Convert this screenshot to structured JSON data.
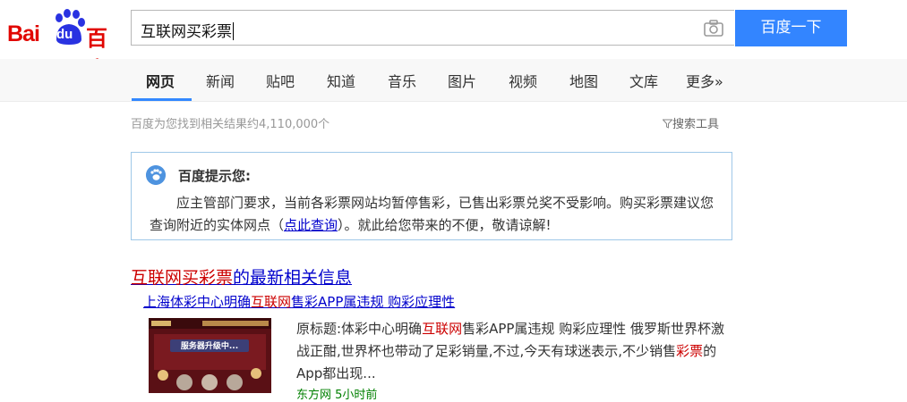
{
  "logo": {
    "latin": "Bai",
    "du": "du",
    "chinese": "百度"
  },
  "search": {
    "query": "互联网买彩票",
    "button_label": "百度一下",
    "camera_icon": "camera-icon"
  },
  "nav": {
    "tabs": [
      "网页",
      "新闻",
      "贴吧",
      "知道",
      "音乐",
      "图片",
      "视频",
      "地图",
      "文库",
      "更多»"
    ],
    "active_index": 0
  },
  "results": {
    "count_text": "百度为您找到相关结果约4,110,000个",
    "tools_label": "搜索工具"
  },
  "notice": {
    "title": "百度提示您:",
    "body_before_link": "应主管部门要求，当前各彩票网站均暂停售彩，已售出彩票兑奖不受影响。购买彩票建议您查询附近的实体网点（",
    "link_text": "点此查询",
    "body_after_link": "）。就此给您带来的不便，敬请谅解!"
  },
  "news": {
    "title_highlight": "互联网买彩票",
    "title_rest": "的最新相关信息",
    "sub_before": "上海体彩中心明确",
    "sub_highlight": "互联网",
    "sub_after": "售彩APP属违规 购彩应理性",
    "desc_1": "原标题:体彩中心明确",
    "desc_hl1": "互联网",
    "desc_2": "售彩APP属违规 购彩应理性 俄罗斯世界杯激战正酣,世界杯也带动了足彩销量,不过,今天有球迷表示,不少销售",
    "desc_hl2": "彩票",
    "desc_3": "的App都出现...",
    "source": "东方网  5小时前",
    "thumb_text": "服务器升级中..."
  },
  "colors": {
    "brand_red": "#e10601",
    "button_blue": "#3385ff",
    "link_blue": "#0000cc",
    "highlight_red": "#cc0000"
  }
}
